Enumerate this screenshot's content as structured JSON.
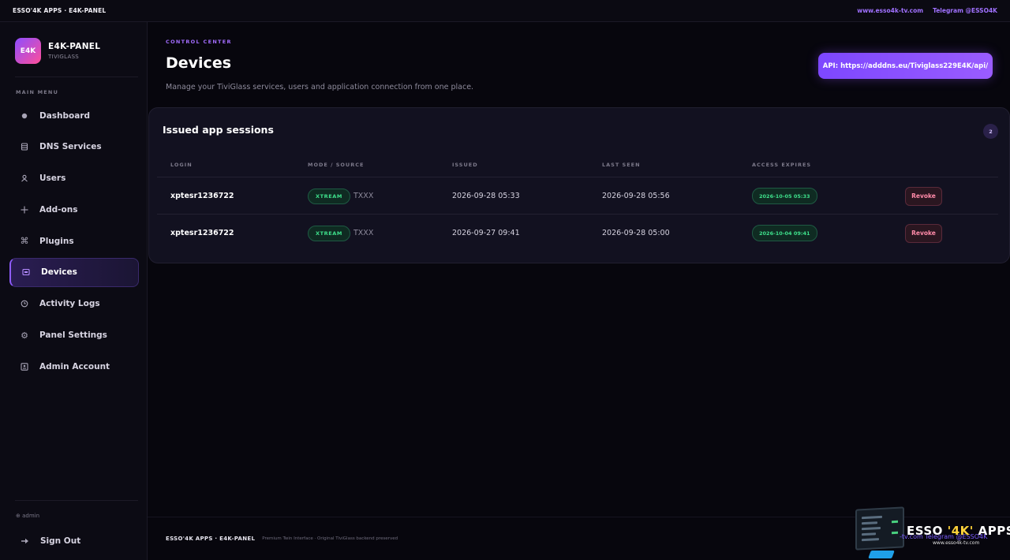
{
  "topbar": {
    "brand": "ESSO'4K APPS · E4K-PANEL",
    "links": [
      "www.esso4k-tv.com",
      "Telegram @ESSO4K"
    ]
  },
  "sidebar": {
    "logo_badge": "E4K",
    "logo_title": "E4K-PANEL",
    "logo_subtitle": "TIVIGLASS",
    "menu_label": "MAIN MENU",
    "items": [
      {
        "label": "Dashboard",
        "icon": "circle-dot-icon"
      },
      {
        "label": "DNS Services",
        "icon": "database-icon"
      },
      {
        "label": "Users",
        "icon": "user-icon"
      },
      {
        "label": "Add-ons",
        "icon": "plus-move-icon"
      },
      {
        "label": "Plugins",
        "icon": "command-icon"
      },
      {
        "label": "Devices",
        "icon": "device-icon",
        "active": true
      },
      {
        "label": "Activity Logs",
        "icon": "clock-icon"
      },
      {
        "label": "Panel Settings",
        "icon": "gear-icon"
      },
      {
        "label": "Admin Account",
        "icon": "id-card-icon"
      }
    ],
    "user": "⊕ admin",
    "signout_label": "Sign Out"
  },
  "header": {
    "eyebrow": "CONTROL CENTER",
    "title": "Devices",
    "description": "Manage your TiviGlass services, users and application connection from one place.",
    "api_button": "API: https://adddns.eu/Tiviglass229E4K/api/"
  },
  "sessions": {
    "title": "Issued app sessions",
    "count": "2",
    "columns": [
      "LOGIN",
      "MODE / SOURCE",
      "ISSUED",
      "LAST SEEN",
      "ACCESS EXPIRES"
    ],
    "rows": [
      {
        "login": "xptesr1236722",
        "mode": "XTREAM",
        "source": "TXXX",
        "issued": "2026-09-28 05:33",
        "last_seen": "2026-09-28 05:56",
        "expires": "2026-10-05 05:33",
        "action": "Revoke"
      },
      {
        "login": "xptesr1236722",
        "mode": "XTREAM",
        "source": "TXXX",
        "issued": "2026-09-27 09:41",
        "last_seen": "2026-09-28 05:00",
        "expires": "2026-10-04 09:41",
        "action": "Revoke"
      }
    ]
  },
  "footer": {
    "brand": "ESSO'4K APPS · E4K-PANEL",
    "note": "Premium Twin Interface · Original TiviGlass backend preserved"
  },
  "watermark": {
    "title_a": "ESSO ",
    "title_b": "'4K'",
    "title_c": " APPS",
    "overlap": "-tv.com     Telegram @ESSO4K",
    "site": "www.esso4k-tv.com"
  },
  "colors": {
    "accent": "#8f5cff",
    "success": "#3ee08b",
    "danger": "#ff8aa8",
    "background": "#07060d"
  }
}
